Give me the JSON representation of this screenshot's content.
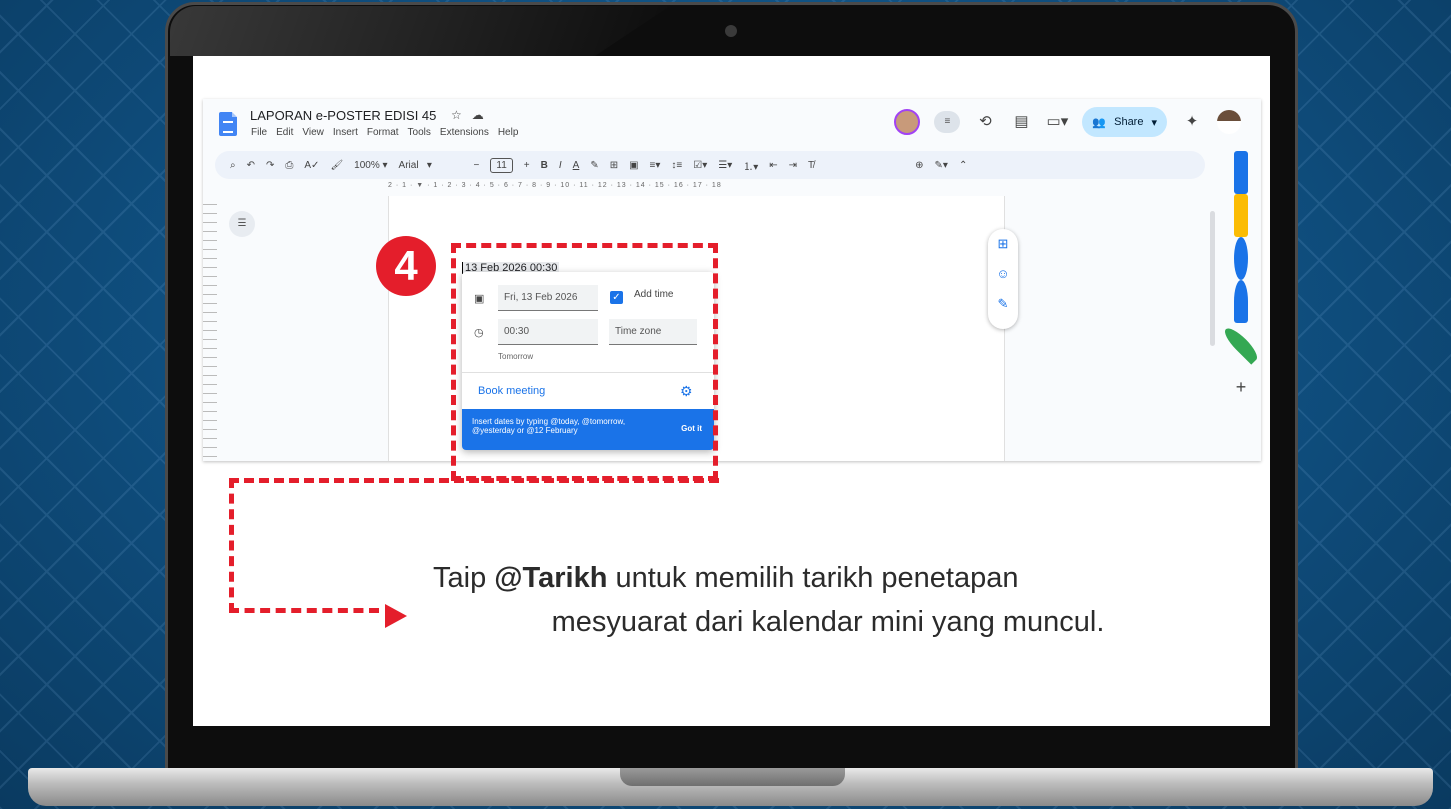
{
  "doc": {
    "title": "LAPORAN e-POSTER EDISI 45",
    "menu": [
      "File",
      "Edit",
      "View",
      "Insert",
      "Format",
      "Tools",
      "Extensions",
      "Help"
    ],
    "share_label": "Share",
    "toolbar": {
      "zoom": "100%",
      "font": "Arial",
      "font_size": "11"
    },
    "ruler_text": "2 · 1 · ▼ · 1 · 2 · 3 · 4 · 5 · 6 · 7 · 8 · 9 · 10 · 11 · 12 · 13 · 14 · 15 · 16 · 17 · 18"
  },
  "date_popup": {
    "inserted_text": "13 Feb 2026 00:30",
    "date_value": "Fri, 13 Feb 2026",
    "add_time_label": "Add time",
    "time_value": "00:30",
    "time_zone_placeholder": "Time zone",
    "helper_text": "Tomorrow",
    "book_meeting_label": "Book meeting",
    "banner_text": "Insert dates by typing @today, @tomorrow, @yesterday or @12 February",
    "got_it_label": "Got it"
  },
  "step_number": "4",
  "instruction": {
    "line1_prefix": "Taip ",
    "line1_bold": "@Tarikh",
    "line1_rest": " untuk memilih tarikh penetapan",
    "line2": "mesyuarat dari kalendar mini yang muncul."
  },
  "colors": {
    "accent_red": "#e41e2b",
    "docs_blue": "#1a73e8"
  }
}
